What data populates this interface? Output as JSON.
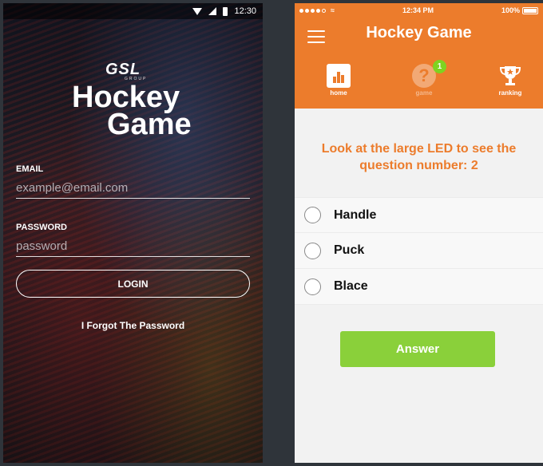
{
  "login_screen": {
    "status_bar": {
      "time": "12:30"
    },
    "logo": {
      "brand": "GSL",
      "brand_sub": "GROUP"
    },
    "title_line1": "Hockey",
    "title_line2": "Game",
    "email": {
      "label": "EMAIL",
      "placeholder": "example@email.com"
    },
    "password": {
      "label": "PASSWORD",
      "placeholder": "password"
    },
    "login_label": "LOGIN",
    "forgot_label": "I Forgot The Password"
  },
  "quiz_screen": {
    "status_bar": {
      "time": "12:34 PM",
      "battery": "100%"
    },
    "header": {
      "title": "Hockey Game"
    },
    "nav": [
      {
        "label": "home",
        "icon": "bar-chart-icon"
      },
      {
        "label": "game",
        "icon": "question-icon",
        "badge": "1"
      },
      {
        "label": "ranking",
        "icon": "trophy-icon"
      }
    ],
    "question": "Look at the large LED to see the question number: 2",
    "options": [
      "Handle",
      "Puck",
      "Blace"
    ],
    "answer_label": "Answer"
  },
  "colors": {
    "accent": "#ec7c2c",
    "answer_button": "#8ad03a",
    "badge": "#7ed321"
  }
}
